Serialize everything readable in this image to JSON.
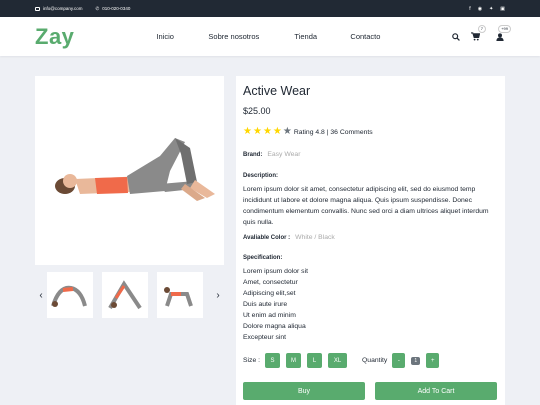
{
  "topbar": {
    "email": "info@company.com",
    "phone": "010-020-0340",
    "social_icons": [
      "facebook-icon",
      "instagram-icon",
      "twitter-icon",
      "linkedin-icon"
    ]
  },
  "nav": {
    "logo": "Zay",
    "menu": [
      "Inicio",
      "Sobre nosotros",
      "Tienda",
      "Contacto"
    ],
    "cart_count": "7",
    "user_count": "+99"
  },
  "product": {
    "title": "Active Wear",
    "price": "$25.00",
    "rating_stars": 4,
    "rating_text": "Rating 4.8 | 36 Comments",
    "brand_label": "Brand:",
    "brand_value": "Easy Wear",
    "description_label": "Description:",
    "description": "Lorem ipsum dolor sit amet, consectetur adipiscing elit, sed do eiusmod temp incididunt ut labore et dolore magna aliqua. Quis ipsum suspendisse. Donec condimentum elementum convallis. Nunc sed orci a diam ultrices aliquet interdum quis nulla.",
    "color_label": "Avaliable Color :",
    "color_value": "White / Black",
    "spec_label": "Specification:",
    "specs": [
      "Lorem ipsum dolor sit",
      "Amet, consectetur",
      "Adipiscing elit,set",
      "Duis aute irure",
      "Ut enim ad minim",
      "Dolore magna aliqua",
      "Excepteur sint"
    ],
    "size_label": "Size :",
    "sizes": [
      "S",
      "M",
      "L",
      "XL"
    ],
    "quantity_label": "Quantity",
    "quantity_minus": "-",
    "quantity_value": "1",
    "quantity_plus": "+",
    "buy_label": "Buy",
    "add_to_cart_label": "Add To Cart"
  },
  "colors": {
    "brand_green": "#59ab6e",
    "dark": "#212934",
    "star": "#ffd700"
  }
}
